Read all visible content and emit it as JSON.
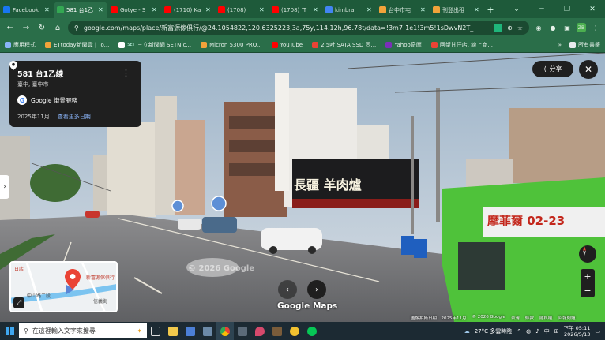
{
  "browser": {
    "tabs": [
      {
        "label": "Facebook",
        "color": "#1877f2"
      },
      {
        "label": "581 台1乙",
        "color": "#34a853",
        "active": true
      },
      {
        "label": "Gotye - S",
        "color": "#ff0000"
      },
      {
        "label": "(1710) Ka",
        "color": "#ff0000"
      },
      {
        "label": "(1708)",
        "color": "#ff0000"
      },
      {
        "label": "(1708) ‘T",
        "color": "#ff0000"
      },
      {
        "label": "kimbra",
        "color": "#4285f4"
      },
      {
        "label": "台中市宅",
        "color": "#f2a33a"
      },
      {
        "label": "刊登出租",
        "color": "#f2a33a"
      }
    ],
    "new_tab": "+",
    "url": "google.com/maps/place/新富源傢俱行/@24.1054822,120.6325223,3a,75y,114.12h,96.78t/data=!3m7!1e1!3m5!1sDwvN2T_",
    "bookmarks": [
      {
        "label": "應用程式",
        "color": "#8ab4f8"
      },
      {
        "label": "ETtoday新聞雲 | To...",
        "color": "#f2a33a"
      },
      {
        "label": "三立新聞網 SETN.c...",
        "color": "#ffffff",
        "tag": "SET"
      },
      {
        "label": "Micron 5300 PRO...",
        "color": "#f2a33a"
      },
      {
        "label": "YouTube",
        "color": "#ff0000"
      },
      {
        "label": "2.5吋 SATA SSD 固...",
        "color": "#ea4335"
      },
      {
        "label": "Yahoo奇摩",
        "color": "#7b2fb8"
      },
      {
        "label": "阿望甘仔店, 線上商...",
        "color": "#ea4335"
      }
    ],
    "bookmarks_more": "»",
    "all_bookmarks": "所有書籤"
  },
  "streetview": {
    "place_title": "581 台1乙線",
    "place_sub": "臺中, 臺中市",
    "service": "Google 街景服務",
    "date": "2025年11月",
    "more_dates": "查看更多日期",
    "share_label": "分享",
    "watermark": "© 2026 Google",
    "shop_sign": "長疆 羊肉爐",
    "bus_sign": "摩菲爾 02-23",
    "minimap_label_1": "中山路二段",
    "minimap_label_2": "日店",
    "minimap_place": "新富源傢俱行",
    "minimap_road": "信義街",
    "logo_text": "Google Maps",
    "footer": [
      "圖像拍攝日期：2025年11月",
      "© 2026 Google",
      "台灣",
      "條款",
      "隱私權",
      "回報問題"
    ]
  },
  "taskbar": {
    "search_placeholder": "在這裡輸入文字來搜尋",
    "weather": "27°C  多雲時陰",
    "ime": "中",
    "time": "下午 05:11",
    "date": "2026/5/13"
  }
}
